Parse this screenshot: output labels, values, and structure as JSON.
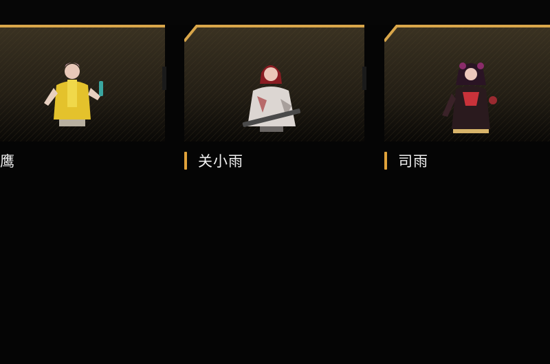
{
  "characters": [
    {
      "name": "鹰"
    },
    {
      "name": "关小雨"
    },
    {
      "name": "司雨"
    }
  ],
  "colors": {
    "card_gold": "#d9a64a",
    "card_fill_top": "#3a3222",
    "card_fill_bottom": "#090806",
    "accent_bar": "#e0a23a",
    "text": "#f2f2f2",
    "background": "#050505"
  }
}
